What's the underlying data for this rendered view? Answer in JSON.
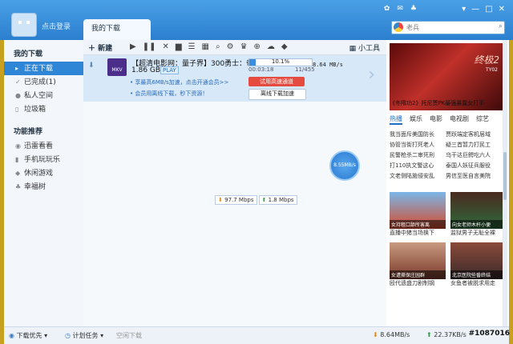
{
  "header": {
    "login": "点击登录",
    "tab": "我的下载",
    "search_placeholder": "老兵"
  },
  "sidebar": {
    "section1": "我的下载",
    "items": [
      {
        "label": "正在下载"
      },
      {
        "label": "已完成(1)"
      },
      {
        "label": "私人空间"
      },
      {
        "label": "垃圾箱"
      }
    ],
    "section2": "功能推荐",
    "features": [
      {
        "label": "迅雷看看"
      },
      {
        "label": "手机玩玩乐"
      },
      {
        "label": "休闲游戏"
      },
      {
        "label": "幸福树"
      }
    ]
  },
  "toolbar": {
    "new_label": "新建",
    "tools_label": "小工具"
  },
  "task": {
    "name": "【超清电影网：量子界】300勇士：帝国…",
    "size": "1.86 GB",
    "play": "PLAY",
    "progress_pct": "10.1%",
    "progress_value": 0.101,
    "elapsed": "00:03:18",
    "seeds": "11/455",
    "speed": "8.64  MB/s",
    "promo1": "享最高6MB/s加速，点击开通会员>>",
    "promo2": "会员用离线下载，秒下资源！",
    "btn_trial": "试用高速通道",
    "btn_offline": "离线下载加速"
  },
  "bubble": "8.55MB/s",
  "speedchip": {
    "down": "97.7 Mbps",
    "up": "1.8 Mbps"
  },
  "right": {
    "hero_logo": "终极2",
    "hero_sub": "TY02",
    "hero_caption": "《冬隋功2》托尼贾PK最强暴露女打手",
    "tabs": [
      "热播",
      "娱乐",
      "电影",
      "电视剧",
      "综艺"
    ],
    "news": [
      "我当面斥美国防长",
      "贾跃端定客机层域",
      "协管当街打死老人",
      "疑三首暂力打民工",
      "民警枪杀二审死刑",
      "乌干达巨鳄吃六人",
      "打110执文警这心",
      "泰国人妖征兵服役",
      "文老侧陆施侵安乱",
      "男信至医自言美院"
    ],
    "thumbs": [
      {
        "caption": "女持租口舔所害离",
        "title": "直播中猪当场换下"
      },
      {
        "caption": "向女老师木杆小便",
        "title": "监狱男子无耻全裸"
      },
      {
        "caption": "女遭撕保庄园群",
        "title": "殴代遗盛刀剧制钢"
      },
      {
        "caption": "北京医院些番终结",
        "title": "女鱼者被脱求用走"
      }
    ]
  },
  "status": {
    "mode": "下载优先",
    "schedule": "计划任务",
    "offline": "空闲下载",
    "down_speed": "8.64MB/s",
    "up_speed": "22.37KB/s"
  },
  "watermark": "#1087016"
}
